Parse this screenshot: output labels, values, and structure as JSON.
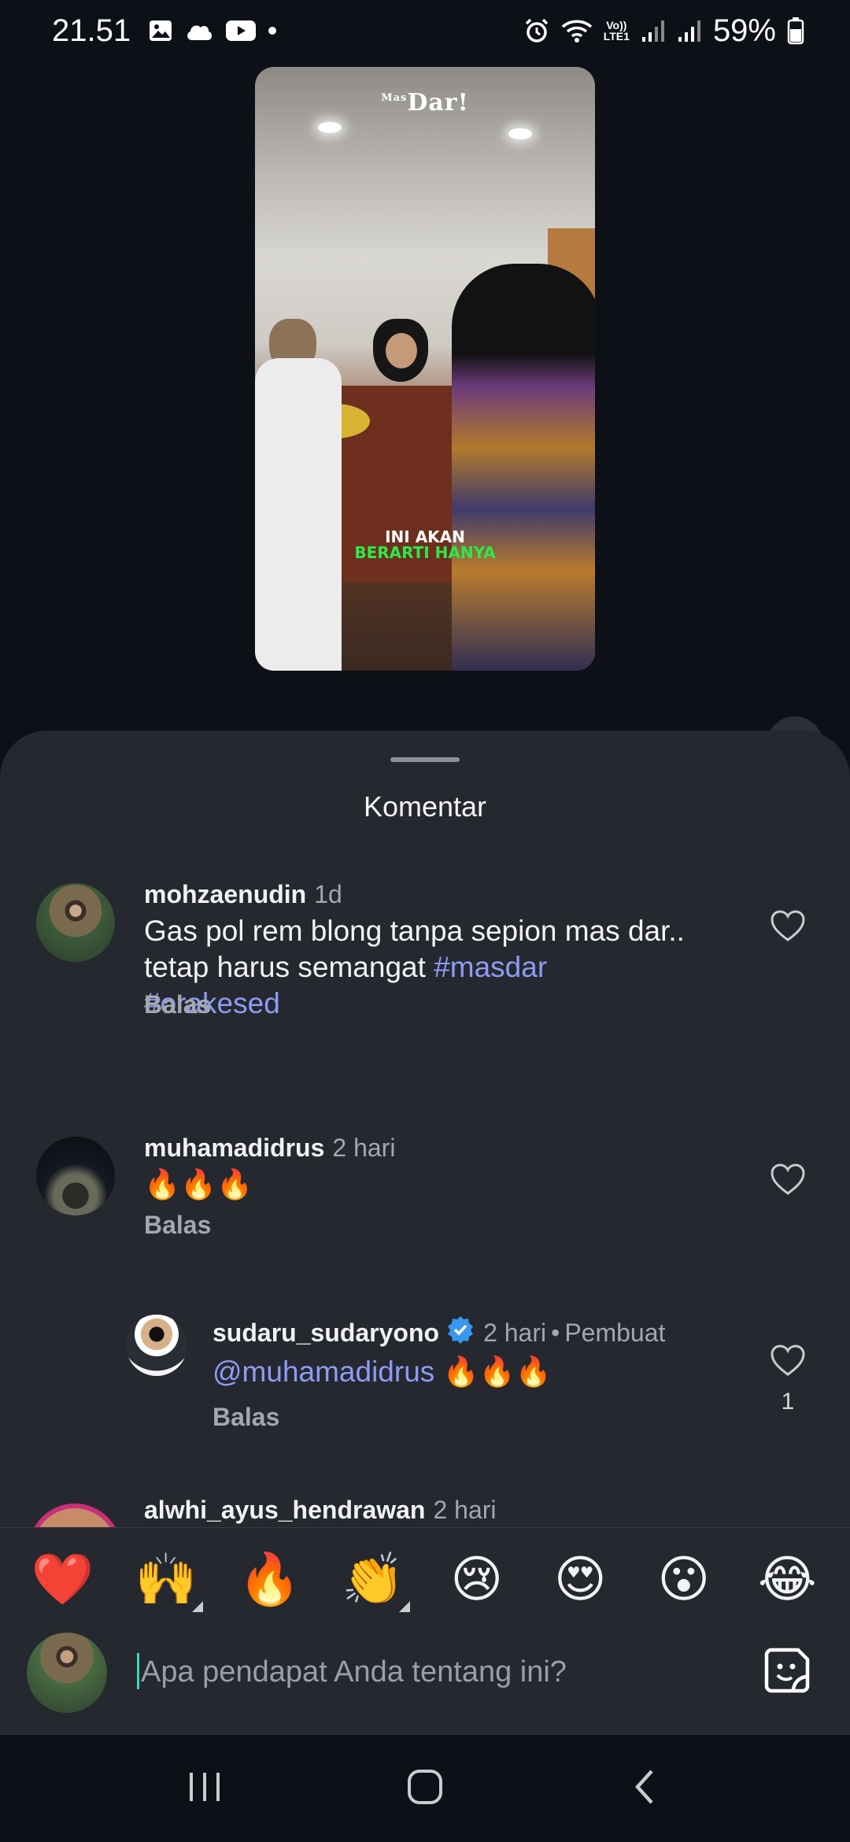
{
  "status_bar": {
    "time": "21.51",
    "battery_percent": "59%",
    "network_label_top": "Vo))",
    "network_label_bottom": "LTE1"
  },
  "video": {
    "logo_small": "Mas",
    "logo": "Dar!",
    "caption_line1": "INI AKAN",
    "caption_line2": "BERARTI HANYA"
  },
  "comments_sheet": {
    "title": "Komentar",
    "comments": [
      {
        "username": "mohzaenudin",
        "time": "1d",
        "text_line1": "Gas pol rem blong tanpa sepion mas dar..",
        "text_line2": "tetap harus semangat",
        "hashtag1": "#masdar",
        "hashtag2": "#orakesed",
        "reply_label": "Balas"
      },
      {
        "username": "muhamadidrus",
        "time": "2 hari",
        "text": "🔥🔥🔥",
        "reply_label": "Balas"
      },
      {
        "username": "sudaru_sudaryono",
        "time": "2 hari",
        "creator_badge": "Pembuat",
        "mention": "@muhamadidrus",
        "text": " 🔥🔥🔥",
        "reply_label": "Balas",
        "like_count": "1"
      },
      {
        "username": "alwhi_ayus_hendrawan",
        "time": "2 hari"
      }
    ]
  },
  "reactions": [
    "❤️",
    "🙌",
    "🔥",
    "👏",
    "😢",
    "😍",
    "😮",
    "😂"
  ],
  "input": {
    "placeholder": "Apa pendapat Anda tentang ini?"
  },
  "colors": {
    "background": "#0d1016",
    "sheet": "#25282e",
    "hashtag": "#8d9cf4",
    "verified": "#3897f0",
    "caption_green": "#2ee84b"
  }
}
